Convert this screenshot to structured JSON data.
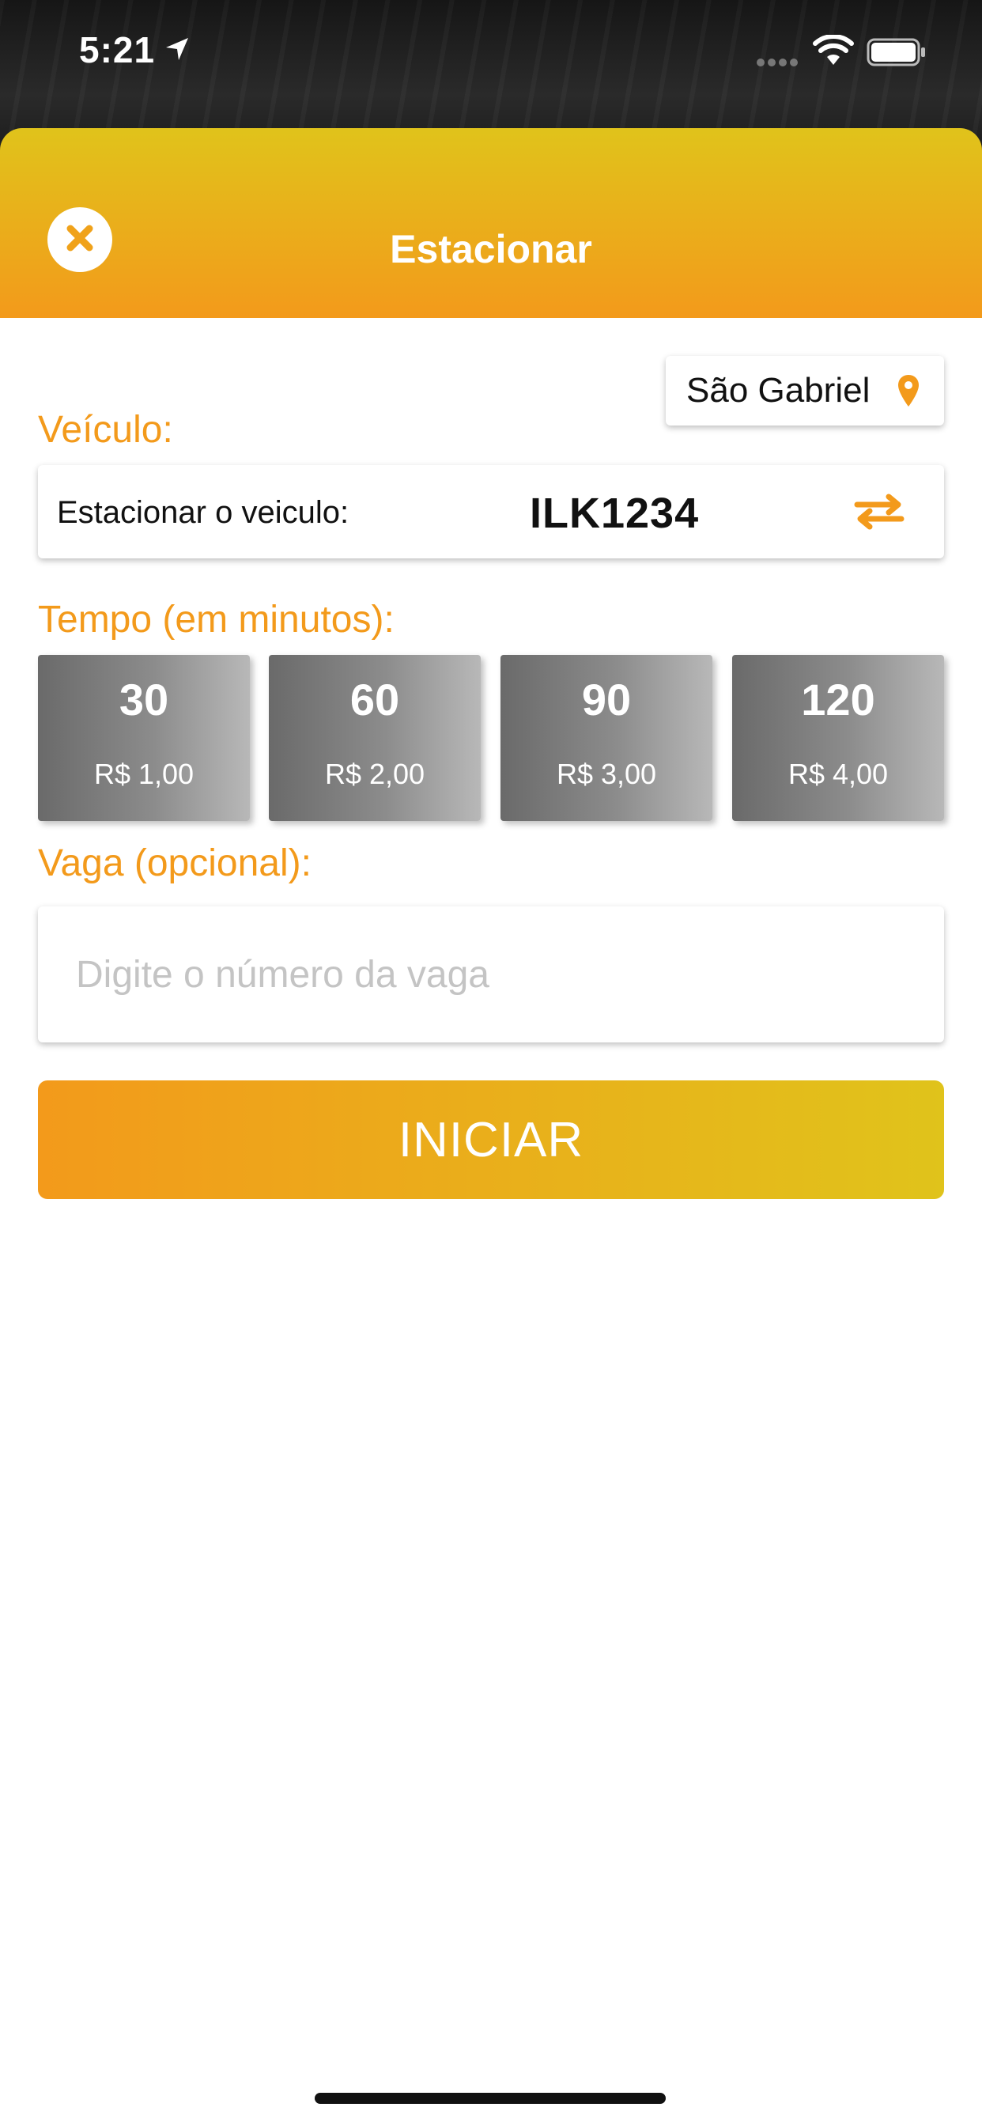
{
  "status_bar": {
    "time": "5:21"
  },
  "header": {
    "title": "Estacionar"
  },
  "city": {
    "name": "São Gabriel"
  },
  "vehicle": {
    "section_label": "Veículo:",
    "prompt": "Estacionar o veiculo:",
    "plate": "ILK1234"
  },
  "time": {
    "section_label": "Tempo (em minutos):",
    "options": [
      {
        "minutes": "30",
        "price": "R$ 1,00"
      },
      {
        "minutes": "60",
        "price": "R$ 2,00"
      },
      {
        "minutes": "90",
        "price": "R$ 3,00"
      },
      {
        "minutes": "120",
        "price": "R$ 4,00"
      }
    ]
  },
  "vaga": {
    "section_label": "Vaga (opcional):",
    "placeholder": "Digite o número da vaga",
    "value": ""
  },
  "start_button": {
    "label": "INICIAR"
  },
  "colors": {
    "accent_orange": "#f39a1b",
    "accent_yellow": "#e0c31b"
  }
}
